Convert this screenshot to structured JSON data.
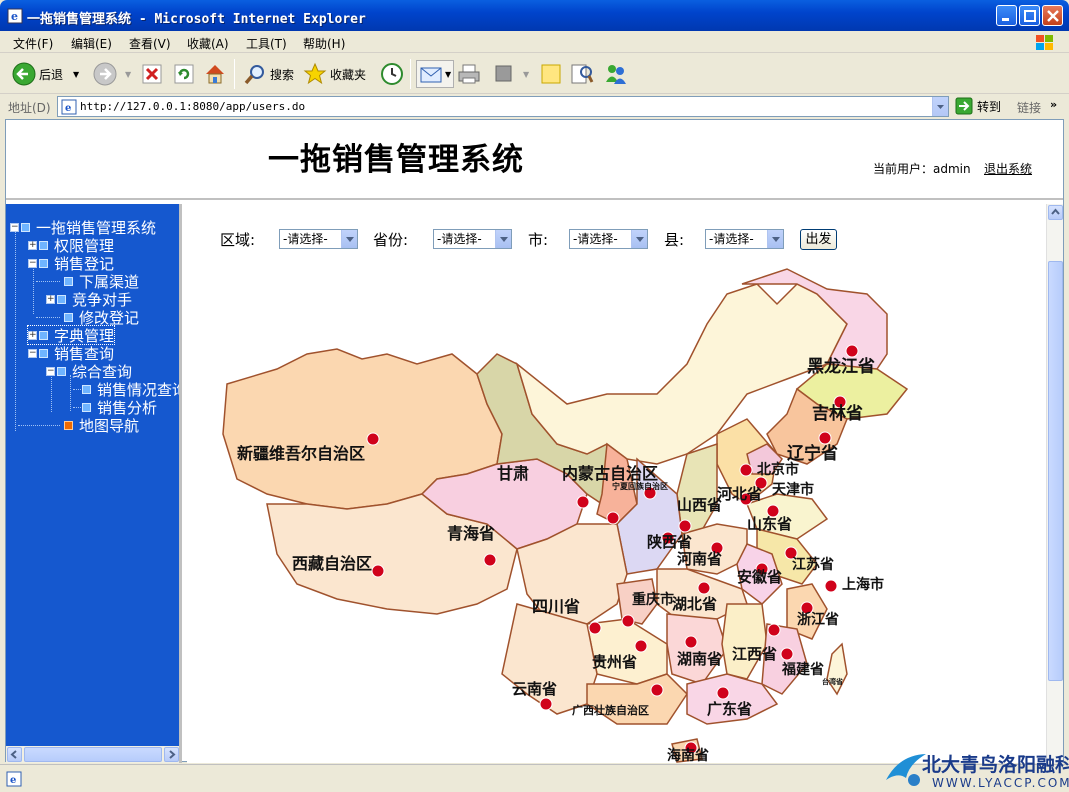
{
  "window": {
    "title": "一拖销售管理系统 - Microsoft Internet Explorer"
  },
  "menu": [
    "文件(F)",
    "编辑(E)",
    "查看(V)",
    "收藏(A)",
    "工具(T)",
    "帮助(H)"
  ],
  "toolbar": {
    "back": "后退",
    "search": "搜索",
    "favorites": "收藏夹"
  },
  "address": {
    "label": "地址(D)",
    "url": "http://127.0.0.1:8080/app/users.do",
    "go": "转到",
    "links": "链接"
  },
  "header": {
    "title": "一拖销售管理系统",
    "user_label": "当前用户：admin",
    "logout": "退出系统"
  },
  "tree": {
    "root": "一拖销售管理系统",
    "items": [
      "权限管理",
      "销售登记",
      "下属渠道",
      "竞争对手",
      "修改登记",
      "字典管理",
      "销售查询",
      "综合查询",
      "销售情况查询",
      "销售分析",
      "地图导航"
    ]
  },
  "filters": {
    "region_label": "区域:",
    "province_label": "省份:",
    "city_label": "市:",
    "county_label": "县:",
    "placeholder": "-请选择-",
    "go_button": "出发"
  },
  "map": {
    "provinces": [
      "黑龙江省",
      "吉林省",
      "辽宁省",
      "北京市",
      "天津市",
      "河北省",
      "山东省",
      "江苏省",
      "上海市",
      "浙江省",
      "安徽省",
      "河南省",
      "山西省",
      "陕西省",
      "宁夏回族自治区",
      "甘肃",
      "内蒙古自治区",
      "新疆维吾尔自治区",
      "青海省",
      "西藏自治区",
      "四川省",
      "重庆市",
      "湖北省",
      "湖南省",
      "江西省",
      "福建省",
      "贵州省",
      "云南省",
      "广西壮族自治区",
      "广东省",
      "海南省",
      "台湾省"
    ]
  },
  "watermark": {
    "brand": "北大青鸟洛阳融科",
    "url": "WWW.LYACCP.COM"
  }
}
